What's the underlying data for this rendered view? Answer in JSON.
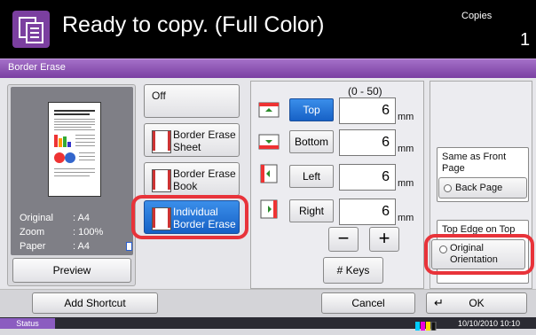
{
  "header": {
    "title": "Ready to copy. (Full Color)",
    "copies_label": "Copies",
    "copies_value": "1"
  },
  "screen_title": "Border Erase",
  "preview": {
    "original_label": "Original",
    "original_value": ": A4",
    "zoom_label": "Zoom",
    "zoom_value": ": 100%",
    "paper_label": "Paper",
    "paper_value": ": A4",
    "button": "Preview"
  },
  "modes": [
    {
      "label": "Off"
    },
    {
      "label": "Border Erase Sheet"
    },
    {
      "label": "Border Erase Book"
    },
    {
      "label": "Individual Border Erase",
      "selected": true
    }
  ],
  "edges": {
    "range": "(0 - 50)",
    "unit": "mm",
    "rows": [
      {
        "label": "Top",
        "value": "6",
        "selected": true
      },
      {
        "label": "Bottom",
        "value": "6"
      },
      {
        "label": "Left",
        "value": "6"
      },
      {
        "label": "Right",
        "value": "6"
      }
    ],
    "minus": "−",
    "plus": "+",
    "keys_button": "# Keys"
  },
  "back_page": {
    "group_label": "Same as Front Page",
    "option": "Back Page"
  },
  "top_edge": {
    "group_label": "Top Edge on Top",
    "option": "Original Orientation"
  },
  "bottom": {
    "add_shortcut": "Add Shortcut",
    "cancel": "Cancel",
    "ok": "OK"
  },
  "status": {
    "tab": "Status",
    "datetime": "10/10/2010  10:10"
  },
  "colors": {
    "accent_purple": "#7a3fa2",
    "selected_blue": "#1761c6",
    "highlight_red": "#e8333a"
  }
}
